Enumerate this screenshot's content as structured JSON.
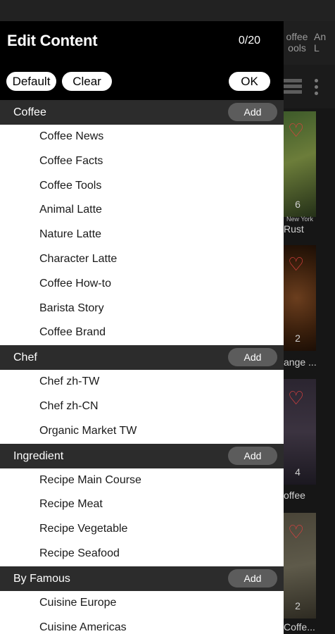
{
  "background": {
    "tabs": [
      "offee\nools",
      "An\nL"
    ],
    "cards": [
      {
        "count": "6",
        "subcaption": "New York",
        "caption": "Rust"
      },
      {
        "count": "2",
        "subcaption": "",
        "caption": "ange ..."
      },
      {
        "count": "4",
        "subcaption": "",
        "caption": "offee"
      },
      {
        "count": "2",
        "subcaption": "",
        "caption": "Coffe..."
      }
    ]
  },
  "drawer": {
    "title": "Edit Content",
    "counter": "0/20",
    "default_label": "Default",
    "clear_label": "Clear",
    "ok_label": "OK"
  },
  "sections": [
    {
      "title": "Coffee",
      "add_label": "Add",
      "items": [
        "Coffee News",
        "Coffee Facts",
        "Coffee Tools",
        "Animal Latte",
        "Nature Latte",
        "Character Latte",
        "Coffee How-to",
        "Barista Story",
        "Coffee Brand"
      ]
    },
    {
      "title": "Chef",
      "add_label": "Add",
      "items": [
        "Chef zh-TW",
        "Chef zh-CN",
        "Organic Market TW"
      ]
    },
    {
      "title": "Ingredient",
      "add_label": "Add",
      "items": [
        "Recipe Main Course",
        "Recipe Meat",
        "Recipe Vegetable",
        "Recipe Seafood"
      ]
    },
    {
      "title": "By Famous",
      "add_label": "Add",
      "items": [
        "Cuisine Europe",
        "Cuisine Americas"
      ]
    }
  ],
  "colors": {
    "drawer_bg": "#000000",
    "section_header_bg": "#2c2c2c",
    "add_button_bg": "#5c5c5c",
    "item_bg": "#ffffff",
    "heart": "#e04040"
  }
}
